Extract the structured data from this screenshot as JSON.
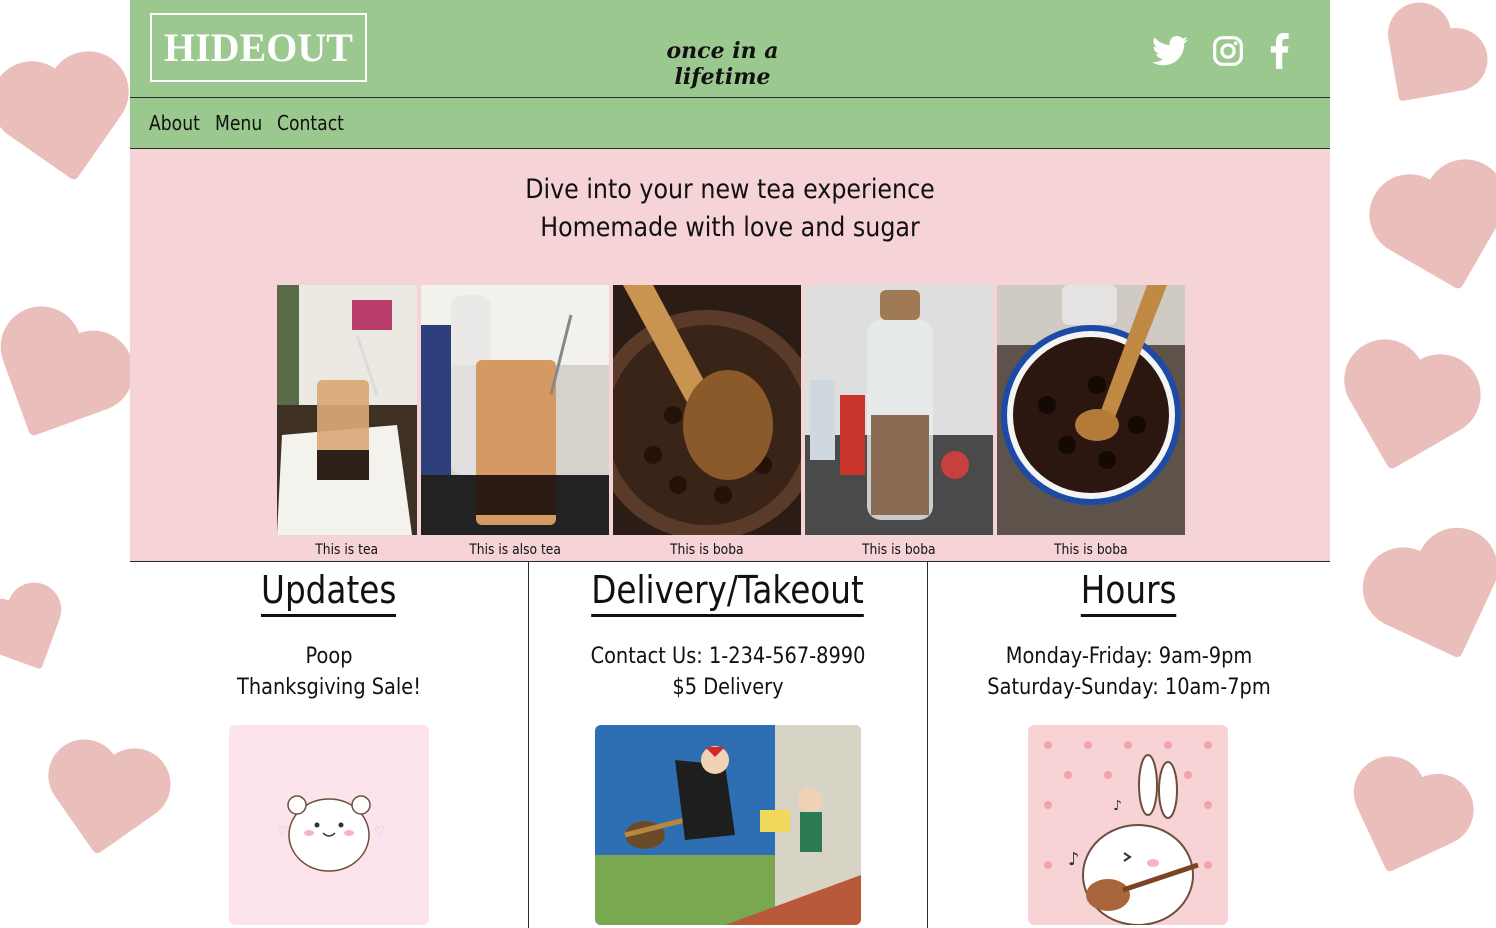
{
  "brand": {
    "logo": "HIDEOUT",
    "tagline": "once in a lifetime"
  },
  "socials": [
    {
      "icon": "twitter-icon"
    },
    {
      "icon": "instagram-icon"
    },
    {
      "icon": "facebook-icon"
    }
  ],
  "nav": {
    "items": [
      "About",
      "Menu",
      "Contact"
    ]
  },
  "hero": {
    "line1": "Dive into your new tea experience",
    "line2": "Homemade with love and sugar"
  },
  "gallery": [
    {
      "caption": "This is tea"
    },
    {
      "caption": "This is also tea"
    },
    {
      "caption": "This is boba"
    },
    {
      "caption": "This is boba"
    },
    {
      "caption": "This is boba"
    }
  ],
  "updates": {
    "title": "Updates",
    "lines": [
      "Poop",
      "Thanksgiving Sale!"
    ]
  },
  "delivery": {
    "title": "Delivery/Takeout",
    "lines": [
      "Contact Us: 1-234-567-8990",
      "$5 Delivery"
    ]
  },
  "hours": {
    "title": "Hours",
    "lines": [
      "Monday-Friday: 9am-9pm",
      "Saturday-Sunday: 10am-7pm"
    ]
  },
  "colors": {
    "header_green": "#9bc88e",
    "hero_pink": "#f6d3d7",
    "heart_pink": "#e4a9a5"
  }
}
